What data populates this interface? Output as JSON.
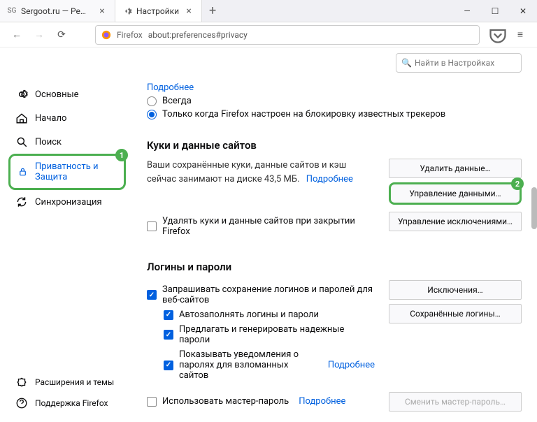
{
  "tabs": [
    {
      "title": "Sergoot.ru — Решение ваших",
      "favicon": "SG"
    },
    {
      "title": "Настройки",
      "favicon": "gear"
    }
  ],
  "url": {
    "prefix": "Firefox",
    "path": "about:preferences#privacy"
  },
  "search": {
    "placeholder": "Найти в Настройках"
  },
  "sidebar": {
    "items": [
      {
        "label": "Основные"
      },
      {
        "label": "Начало"
      },
      {
        "label": "Поиск"
      },
      {
        "label": "Приватность и Защита"
      },
      {
        "label": "Синхронизация"
      }
    ],
    "bottom": [
      {
        "label": "Расширения и темы"
      },
      {
        "label": "Поддержка Firefox"
      }
    ]
  },
  "tracking": {
    "more_link": "Подробнее",
    "opt_always": "Всегда",
    "opt_only": "Только когда Firefox настроен на блокировку известных трекеров"
  },
  "cookies": {
    "title": "Куки и данные сайтов",
    "desc_line": "Ваши сохранённые куки, данные сайтов и кэш сейчас занимают на диске 43,5 МБ.",
    "more_link": "Подробнее",
    "delete_on_close": "Удалять куки и данные сайтов при закрытии Firefox",
    "btn_delete": "Удалить данные…",
    "btn_manage": "Управление данными…",
    "btn_exceptions": "Управление исключениями…"
  },
  "logins": {
    "title": "Логины и пароли",
    "ask_save": "Запрашивать сохранение логинов и паролей для веб-сайтов",
    "autofill": "Автозаполнять логины и пароли",
    "suggest": "Предлагать и генерировать надежные пароли",
    "breach": "Показывать уведомления о паролях для взломанных сайтов",
    "breach_link": "Подробнее",
    "master": "Использовать мастер-пароль",
    "master_link": "Подробнее",
    "btn_exceptions": "Исключения…",
    "btn_saved": "Сохранённые логины…",
    "btn_change_master": "Сменить мастер-пароль…"
  },
  "badges": {
    "one": "1",
    "two": "2"
  }
}
